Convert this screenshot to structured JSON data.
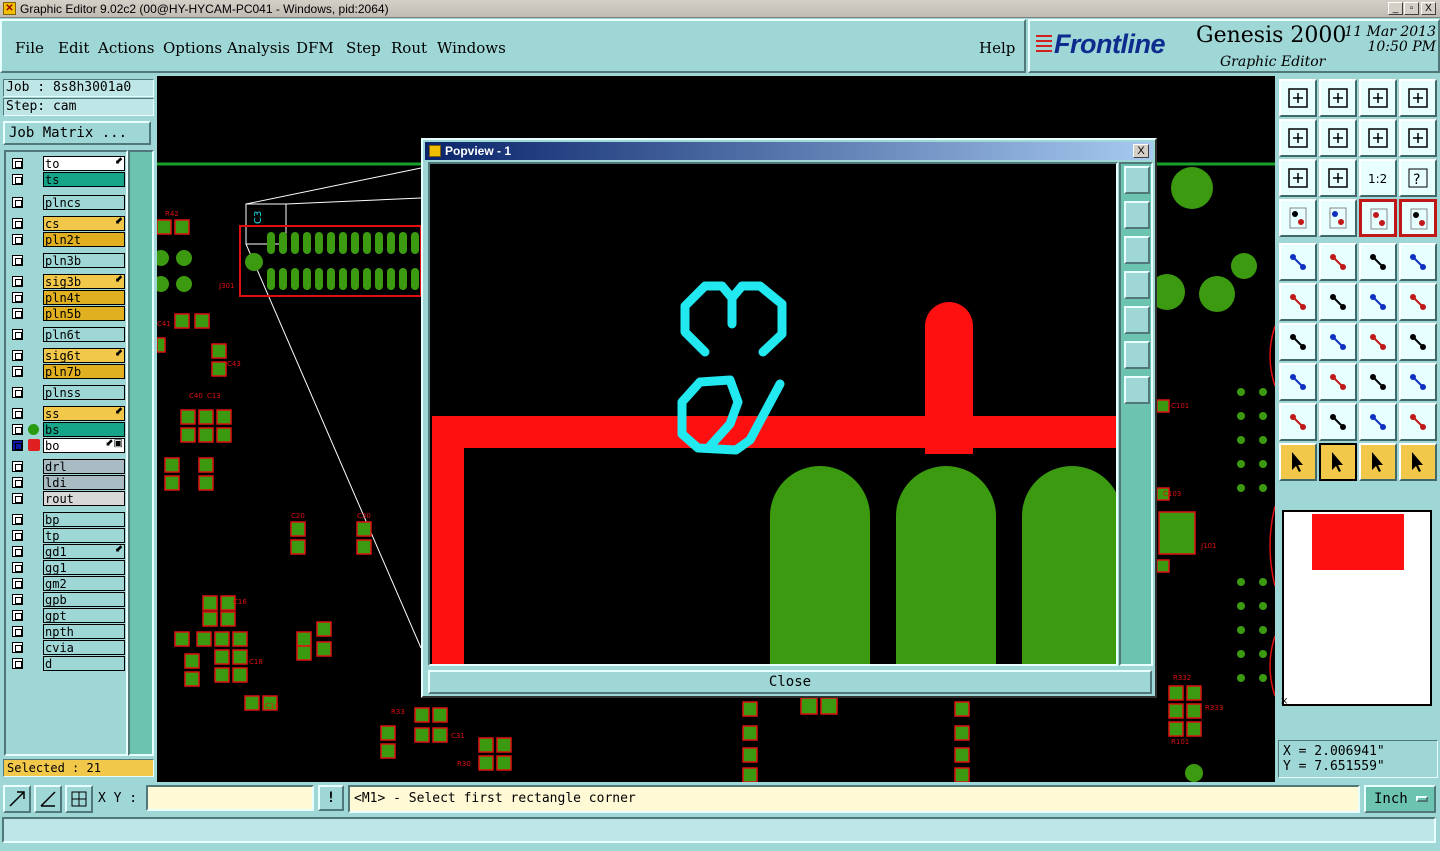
{
  "window": {
    "title": "Graphic Editor 9.02c2 (00@HY-HYCAM-PC041 - Windows, pid:2064)",
    "minimize": "_",
    "maximize": "▫",
    "close": "X"
  },
  "menu": [
    "File",
    "Edit",
    "Actions",
    "Options",
    "Analysis",
    "DFM",
    "Step",
    "Rout",
    "Windows"
  ],
  "help_label": "Help",
  "brand": {
    "logo": "Frontline",
    "product": "Genesis 2000",
    "subtitle": "Graphic Editor",
    "date": "11 Mar 2013",
    "time": "10:50 PM"
  },
  "job": {
    "job_label": "Job : 8s8h3001a0",
    "step_label": "Step: cam",
    "matrix_button": "Job Matrix ..."
  },
  "layers": [
    {
      "name": "to",
      "color": "#ffffff",
      "mark": "⬋"
    },
    {
      "name": "ts",
      "color": "#17a589",
      "mark": ""
    },
    {
      "name": "plncs",
      "color": "#9fd6d6",
      "mark": ""
    },
    {
      "name": "cs",
      "color": "#f2c84b",
      "mark": "⬋"
    },
    {
      "name": "pln2t",
      "color": "#e0b020",
      "mark": ""
    },
    {
      "name": "pln3b",
      "color": "#9fd6d6",
      "mark": ""
    },
    {
      "name": "sig3b",
      "color": "#f2c84b",
      "mark": "⬋"
    },
    {
      "name": "pln4t",
      "color": "#e0b020",
      "mark": ""
    },
    {
      "name": "pln5b",
      "color": "#e0b020",
      "mark": ""
    },
    {
      "name": "pln6t",
      "color": "#9fd6d6",
      "mark": ""
    },
    {
      "name": "sig6t",
      "color": "#f2c84b",
      "mark": "⬋"
    },
    {
      "name": "pln7b",
      "color": "#e0b020",
      "mark": ""
    },
    {
      "name": "plnss",
      "color": "#9fd6d6",
      "mark": ""
    },
    {
      "name": "ss",
      "color": "#f2c84b",
      "mark": "⬋"
    },
    {
      "name": "bs",
      "color": "#17a589",
      "mark": ""
    },
    {
      "name": "bo",
      "color": "#ffffff",
      "mark": "⬋▣"
    },
    {
      "name": "drl",
      "color": "#a9bcc4",
      "mark": ""
    },
    {
      "name": "ldi",
      "color": "#a9bcc4",
      "mark": ""
    },
    {
      "name": "rout",
      "color": "#d8d8d8",
      "mark": ""
    },
    {
      "name": "bp",
      "color": "#9fd6d6",
      "mark": ""
    },
    {
      "name": "tp",
      "color": "#9fd6d6",
      "mark": ""
    },
    {
      "name": "gd1",
      "color": "#9fd6d6",
      "mark": "⬋"
    },
    {
      "name": "gg1",
      "color": "#9fd6d6",
      "mark": ""
    },
    {
      "name": "gm2",
      "color": "#9fd6d6",
      "mark": ""
    },
    {
      "name": "gpb",
      "color": "#9fd6d6",
      "mark": ""
    },
    {
      "name": "gpt",
      "color": "#9fd6d6",
      "mark": ""
    },
    {
      "name": "npth",
      "color": "#9fd6d6",
      "mark": ""
    },
    {
      "name": "cvia",
      "color": "#9fd6d6",
      "mark": ""
    },
    {
      "name": "d",
      "color": "#9fd6d6",
      "mark": ""
    }
  ],
  "selected_label": "Selected : 21",
  "popview": {
    "title": "Popview - 1",
    "close_button": "Close",
    "close_x": "X",
    "silkscreen_text": "C3"
  },
  "coords": {
    "x": "X = 2.006941\"",
    "y": "Y = 7.651559\""
  },
  "bottom": {
    "xy_label": "X Y :",
    "xy_value": "",
    "excl": "!",
    "prompt": "<M1> - Select first rectangle corner",
    "unit": "Inch"
  },
  "component_labels": [
    "R42",
    "R43",
    "C41",
    "C43",
    "C40",
    "C13",
    "C17",
    "C12",
    "C14",
    "C15",
    "C16",
    "C18",
    "C20",
    "C30",
    "C31",
    "C32",
    "R30",
    "R31",
    "R33",
    "R34",
    "R35",
    "R36",
    "C101",
    "C103",
    "C104",
    "R101",
    "J101",
    "R332",
    "R333"
  ]
}
